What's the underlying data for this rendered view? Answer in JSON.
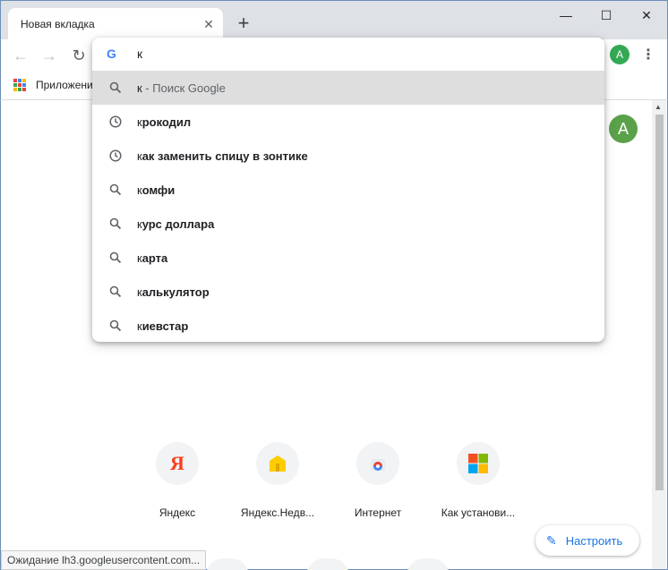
{
  "tab": {
    "title": "Новая вкладка",
    "close": "✕"
  },
  "new_tab": "+",
  "window": {
    "minimize": "—",
    "maximize": "☐",
    "close": "✕"
  },
  "nav": {
    "back": "←",
    "forward": "→",
    "reload": "↻"
  },
  "profile_initial": "A",
  "menu": "⋮",
  "bookmarks": {
    "apps_label": "Приложения"
  },
  "omnibox": {
    "value": "к",
    "logo": "G",
    "suggestions": [
      {
        "prefix": "к",
        "rest": " - Поиск Google",
        "icon": "search-icon",
        "type": "search-what-you-typed"
      },
      {
        "prefix": "к",
        "rest": "рокодил",
        "icon": "history-icon",
        "type": "history"
      },
      {
        "prefix": "к",
        "rest": "ак заменить спицу в зонтике",
        "icon": "history-icon",
        "type": "history"
      },
      {
        "prefix": "к",
        "rest": "омфи",
        "icon": "search-icon",
        "type": "search"
      },
      {
        "prefix": "к",
        "rest": "урс доллара",
        "icon": "search-icon",
        "type": "search"
      },
      {
        "prefix": "к",
        "rest": "арта",
        "icon": "search-icon",
        "type": "search"
      },
      {
        "prefix": "к",
        "rest": "алькулятор",
        "icon": "search-icon",
        "type": "search"
      },
      {
        "prefix": "к",
        "rest": "иевстар",
        "icon": "search-icon",
        "type": "search"
      }
    ]
  },
  "tiles": [
    {
      "label": "Яндекс",
      "icon": "yandex-icon"
    },
    {
      "label": "Яндекс.Недв...",
      "icon": "yandex-realty-icon"
    },
    {
      "label": "Интернет",
      "icon": "chrome-store-icon"
    },
    {
      "label": "Как установи...",
      "icon": "windows-logo-icon"
    }
  ],
  "customize_label": "Настроить",
  "status_text": "Ожидание lh3.googleusercontent.com...",
  "colors": {
    "accent": "#1a73e8",
    "profile": "#34a853",
    "selected_row": "#dedede"
  }
}
